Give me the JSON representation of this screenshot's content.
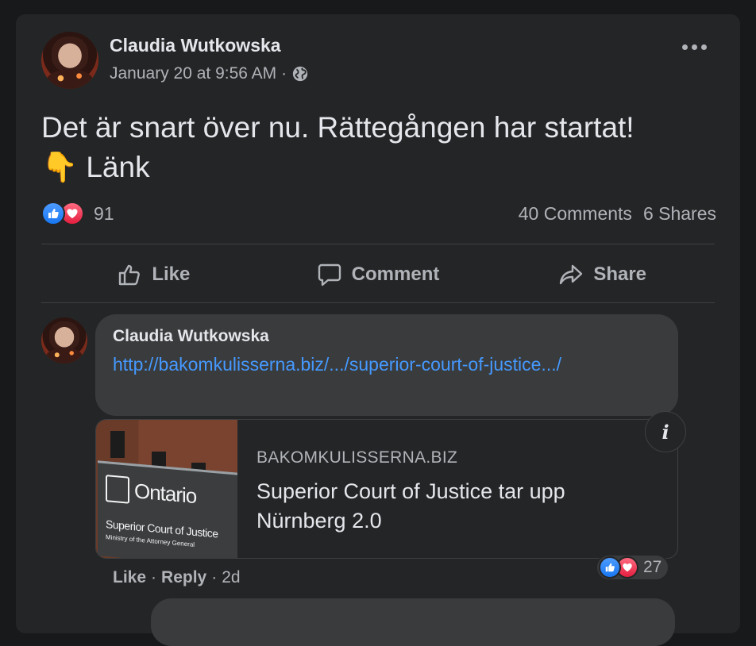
{
  "post": {
    "author": "Claudia Wutkowska",
    "timestamp": "January 20 at 9:56 AM",
    "separator": "·",
    "privacy_icon": "globe-icon",
    "text_line1": "Det är snart över nu. Rättegången har startat!",
    "text_emoji": "👇",
    "text_line2": "Länk"
  },
  "reactions": {
    "icons": [
      "like-icon",
      "love-icon"
    ],
    "count": "91",
    "comments": "40 Comments",
    "shares": "6 Shares"
  },
  "actions": {
    "like": "Like",
    "comment": "Comment",
    "share": "Share"
  },
  "comment": {
    "author": "Claudia Wutkowska",
    "link_text": "http://bakomkulisserna.biz/.../superior-court-of-justice.../",
    "preview": {
      "domain": "BAKOMKULISSERNA.BIZ",
      "title": "Superior Court of Justice tar upp Nürnberg 2.0",
      "sign_ontario": "Ontario",
      "sign_court": "Superior Court of Justice",
      "sign_ministry": "Ministry of the Attorney General"
    },
    "like_label": "Like",
    "reply_label": "Reply",
    "age": "2d",
    "sep": "·",
    "reaction_count": "27"
  },
  "colors": {
    "background": "#18191a",
    "card": "#242526",
    "bubble": "#3a3b3c",
    "link": "#4599ff",
    "like_blue": "#1877f2",
    "love_red": "#e41e3f"
  }
}
